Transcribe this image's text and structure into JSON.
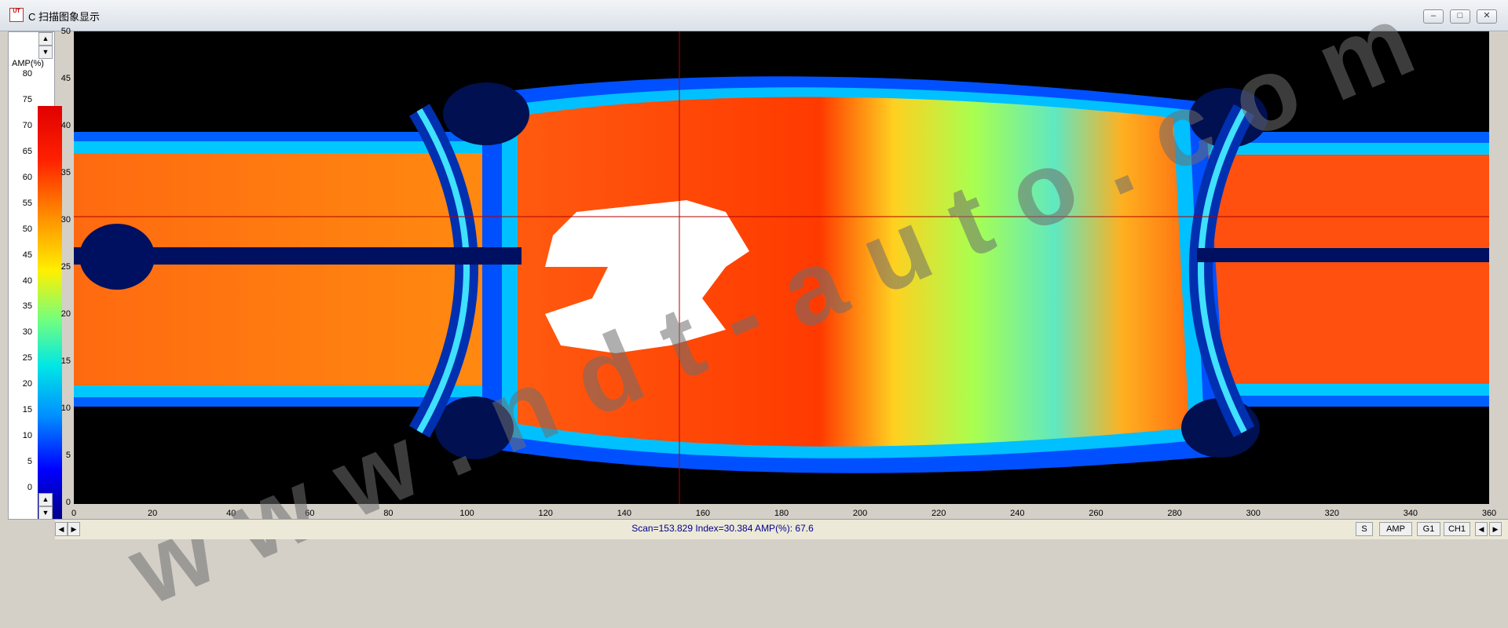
{
  "window": {
    "icon_text": "UT",
    "title": "C 扫描图象显示",
    "minimize": "–",
    "maximize": "□",
    "close": "✕"
  },
  "colorbar": {
    "label": "AMP(%)",
    "ticks": [
      "80",
      "75",
      "70",
      "65",
      "60",
      "55",
      "50",
      "45",
      "40",
      "35",
      "30",
      "25",
      "20",
      "15",
      "10",
      "5",
      "0"
    ]
  },
  "plot": {
    "y_ticks": [
      "50",
      "45",
      "40",
      "35",
      "30",
      "25",
      "20",
      "15",
      "10",
      "5",
      "0"
    ],
    "x_ticks": [
      "0",
      "20",
      "40",
      "60",
      "80",
      "100",
      "120",
      "140",
      "160",
      "180",
      "200",
      "220",
      "240",
      "260",
      "280",
      "300",
      "320",
      "340",
      "360"
    ],
    "cursor_scan": 153.829,
    "cursor_index": 30.384,
    "x_range": [
      0,
      360
    ],
    "y_range": [
      0,
      50
    ]
  },
  "watermark": "www.ndt-auto.com",
  "status": {
    "readout": "Scan=153.829 Index=30.384 AMP(%): 67.6",
    "buttons": [
      "S",
      "AMP",
      "G1",
      "CH1"
    ]
  }
}
